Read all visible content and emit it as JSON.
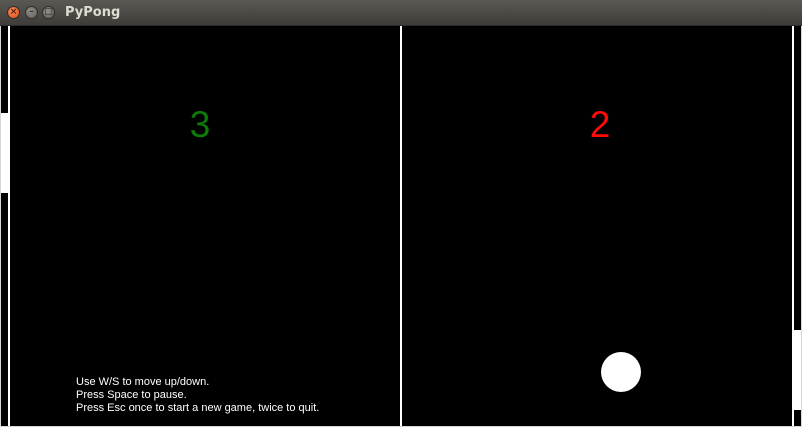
{
  "window": {
    "title": "PyPong",
    "close_icon": "close-icon",
    "minimize_icon": "minimize-icon",
    "maximize_icon": "maximize-icon"
  },
  "game": {
    "left_score": "3",
    "right_score": "2",
    "colors": {
      "left_score": "#0b7a0b",
      "right_score": "#ff0a0a",
      "background": "#000000",
      "foreground": "#ffffff"
    },
    "instructions": [
      "Use W/S to move up/down.",
      "Press Space to pause.",
      "Press Esc once to start a new game, twice to quit."
    ]
  }
}
